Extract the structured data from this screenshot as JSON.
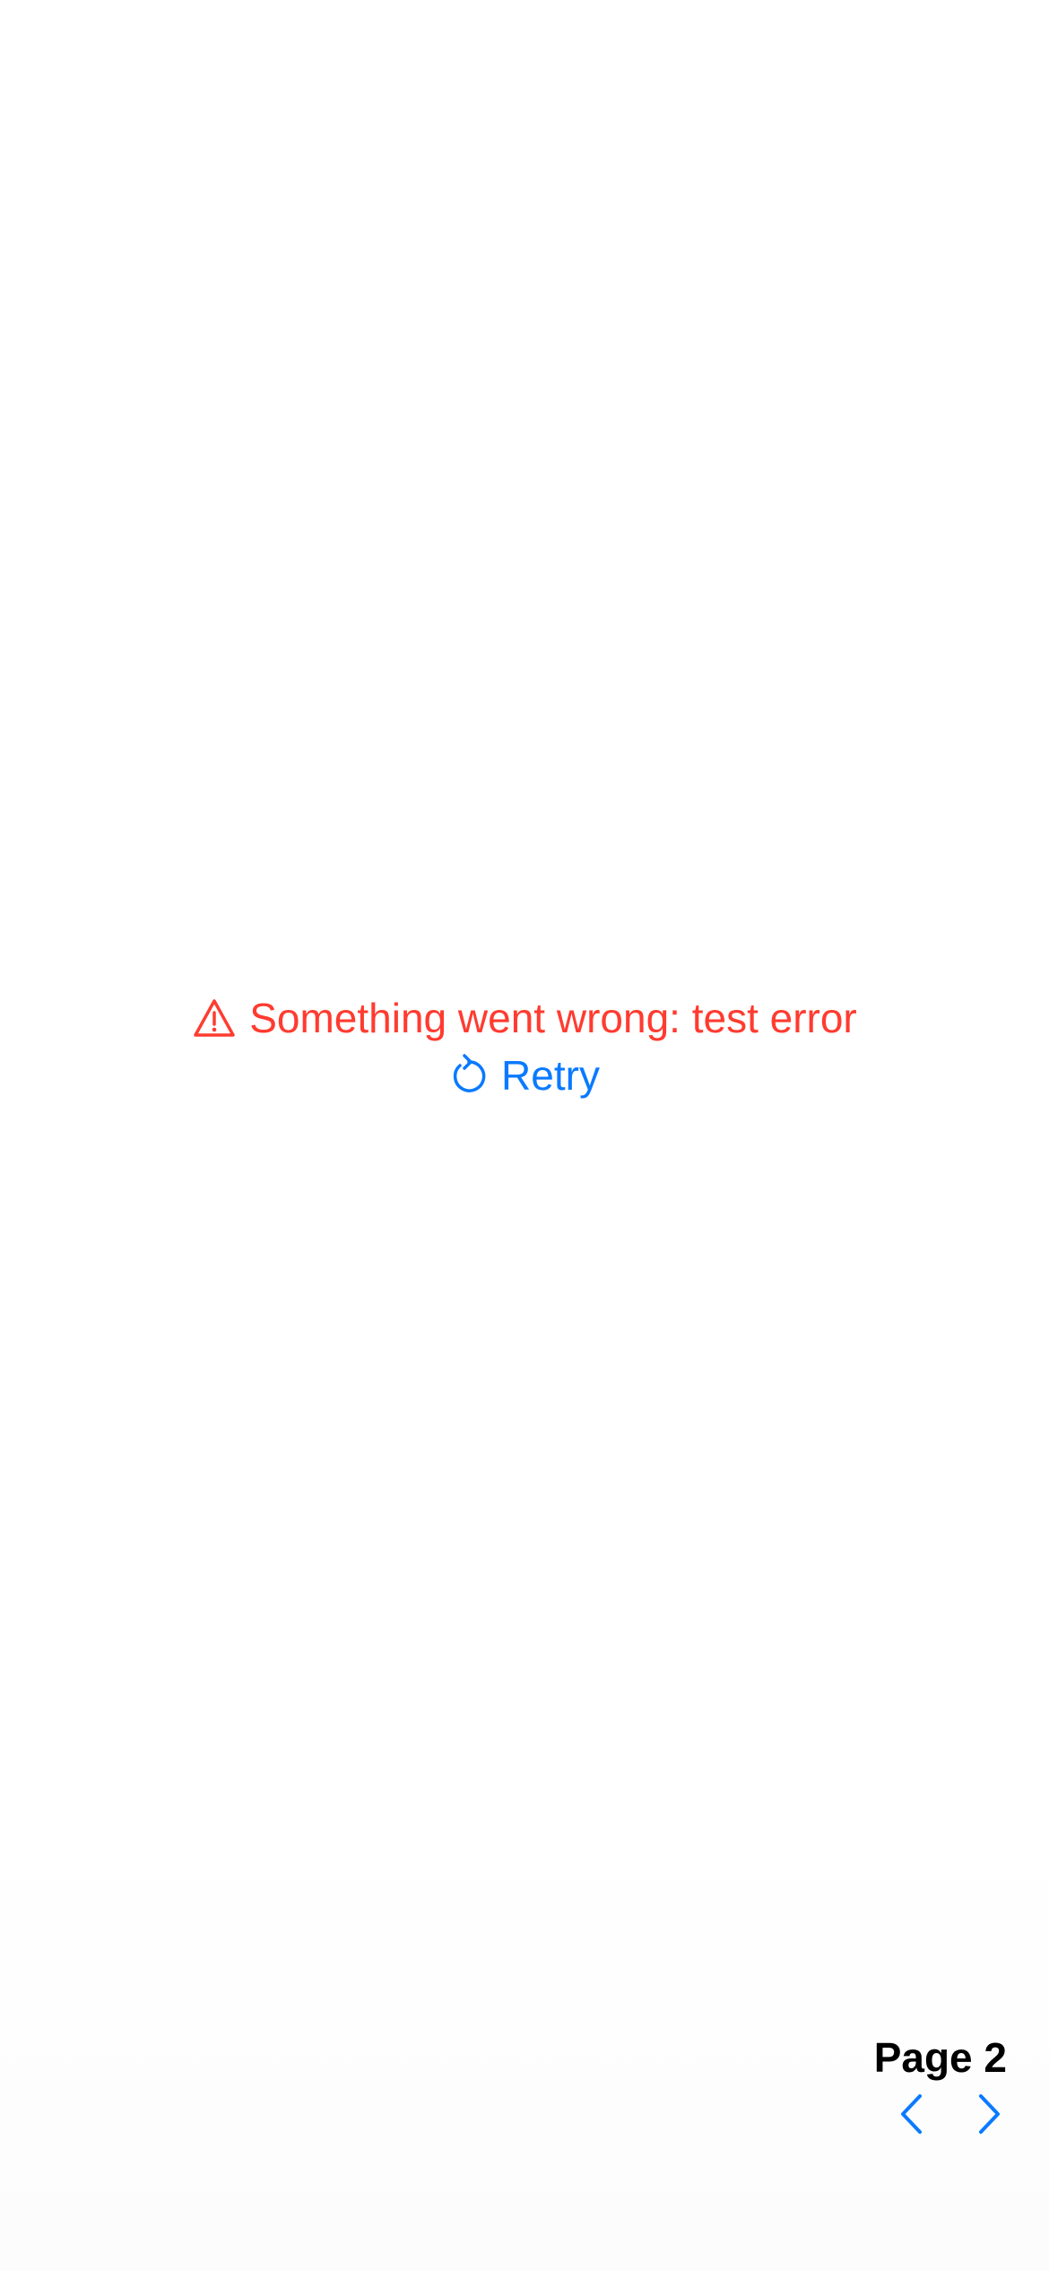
{
  "theme": {
    "error_color": "#ff3b30",
    "accent_color": "#0a7aff",
    "text_color": "#000000"
  },
  "error": {
    "icon": "warning-triangle-icon",
    "message": "Something went wrong: test error"
  },
  "retry": {
    "icon": "arrow-counterclockwise-icon",
    "label": "Retry"
  },
  "pager": {
    "label": "Page 2",
    "prev_icon": "chevron-left-icon",
    "next_icon": "chevron-right-icon"
  }
}
